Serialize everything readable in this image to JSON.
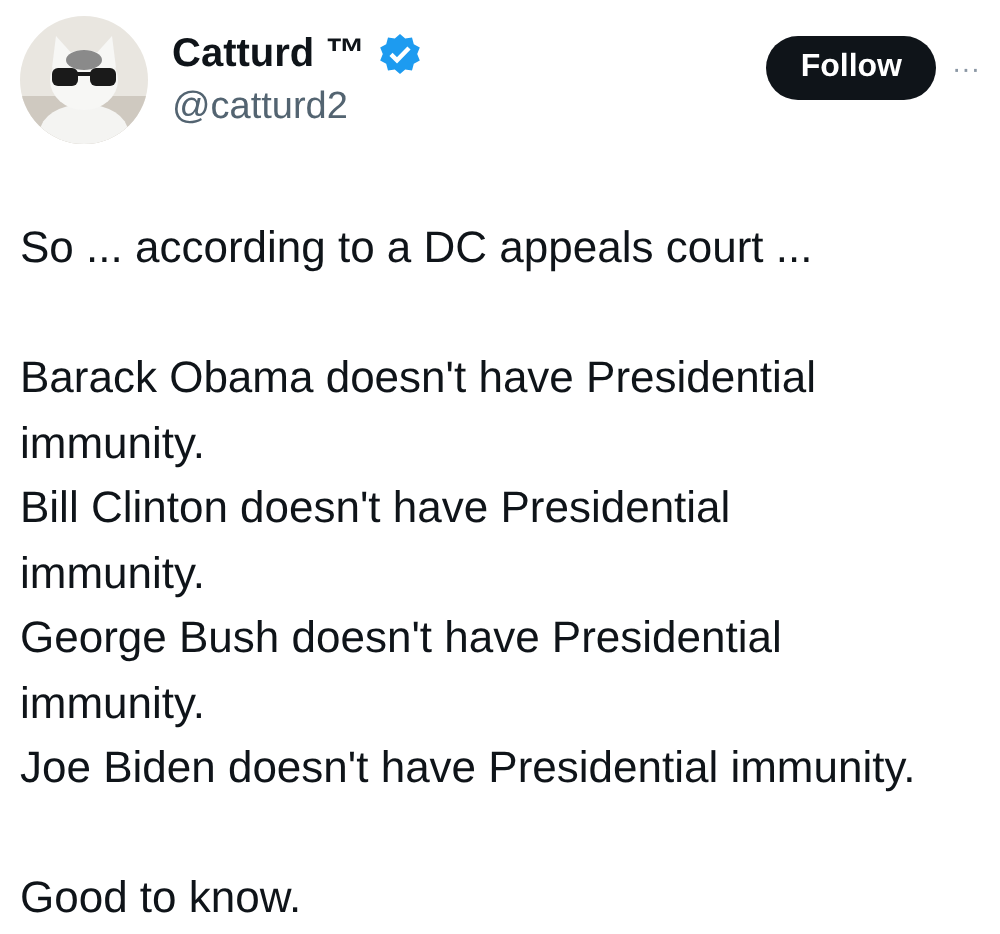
{
  "author": {
    "name": "Catturd ™",
    "verified": true,
    "handle": "@catturd2"
  },
  "follow_button": {
    "label": "Follow"
  },
  "more_menu": {
    "label": "···"
  },
  "body": [
    [
      "So ... according to a DC appeals court ..."
    ],
    [
      "Barack Obama doesn't have Presidential immunity.",
      "Bill Clinton doesn't have Presidential immunity.",
      "George Bush doesn't have Presidential immunity.",
      "Joe Biden doesn't have Presidential immunity."
    ],
    [
      "Good to know."
    ]
  ]
}
